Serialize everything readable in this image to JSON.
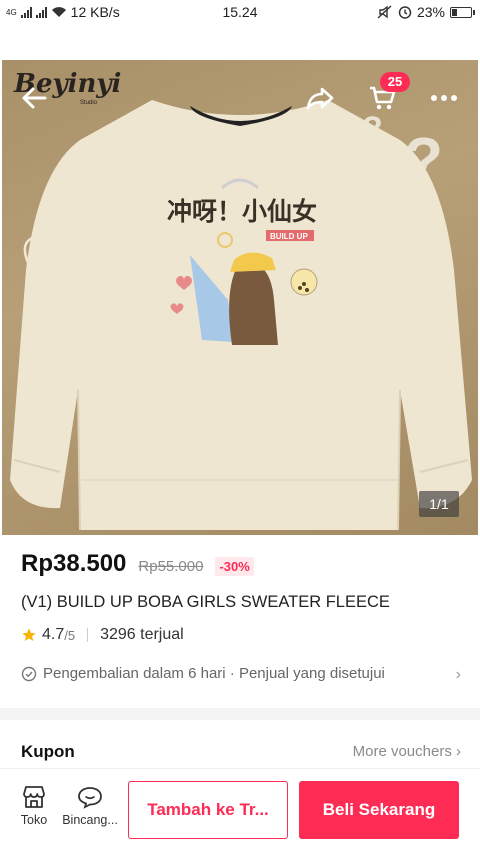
{
  "status_bar": {
    "network_type": "4G",
    "network_speed": "12 KB/s",
    "time": "15.24",
    "battery": "23%",
    "battery_level": 0.23
  },
  "nav": {
    "cart_count": "25",
    "icons": [
      "back-arrow-icon",
      "share-icon",
      "cart-icon",
      "more-icon"
    ]
  },
  "product_image": {
    "brand_logo": "Beyinyi",
    "brand_sub": "Studio",
    "print_text": "冲呀！小仙女",
    "print_label": "BUILD UP",
    "counter": "1/1"
  },
  "product": {
    "price": "Rp38.500",
    "original_price": "Rp55.000",
    "discount": "-30%",
    "title": "(V1) BUILD UP BOBA GIRLS SWEATER FLEECE",
    "rating": "4.7",
    "rating_max": "/5",
    "sold": "3296 terjual",
    "return_policy": "Pengembalian dalam 6 hari · Penjual yang disetujui"
  },
  "kupon": {
    "title": "Kupon",
    "more": "More vouchers"
  },
  "bottom_bar": {
    "shop_label": "Toko",
    "chat_label": "Bincang...",
    "add_to_cart": "Tambah ke Tr...",
    "buy_now": "Beli Sekarang"
  },
  "colors": {
    "accent": "#fe2c55",
    "star": "#f5b400"
  }
}
